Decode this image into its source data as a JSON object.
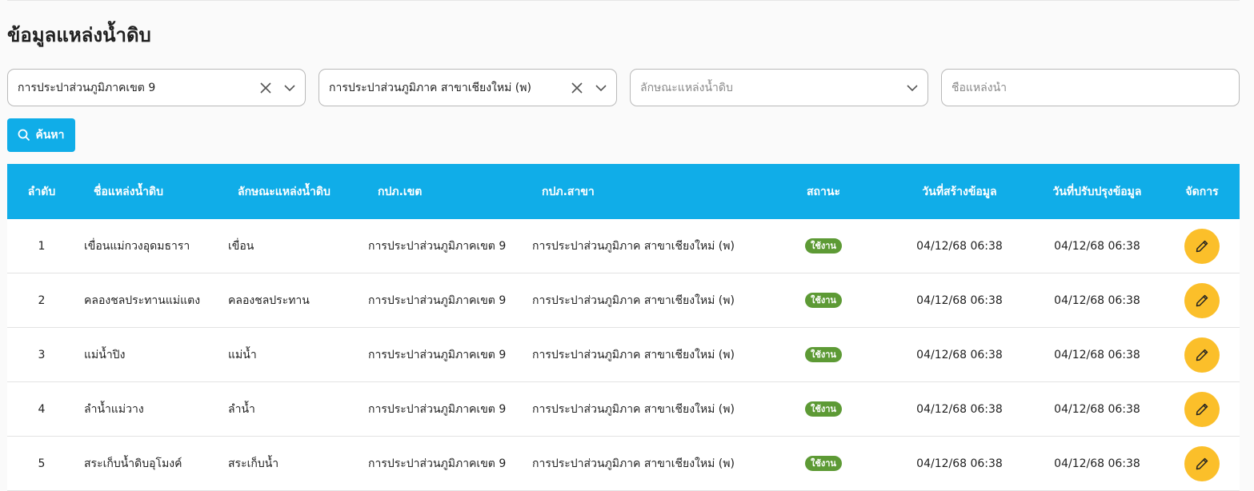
{
  "page": {
    "title": "ข้อมูลแหล่งน้ำดิบ"
  },
  "filters": {
    "zone": {
      "value": "การประปาส่วนภูมิภาคเขต 9"
    },
    "branch": {
      "value": "การประปาส่วนภูมิภาค สาขาเชียงใหม่ (พ)"
    },
    "source_type": {
      "placeholder": "ลักษณะแหล่งน้ำดิบ"
    },
    "source_name": {
      "placeholder": "ชื่อแหล่งน้ำ"
    }
  },
  "search_button": {
    "label": "ค้นหา",
    "icon": "search-icon"
  },
  "table": {
    "headers": {
      "no": "ลำดับ",
      "name": "ชื่อแหล่งน้ำดิบ",
      "type": "ลักษณะแหล่งน้ำดิบ",
      "zone": "กปภ.เขต",
      "branch": "กปภ.สาขา",
      "status": "สถานะ",
      "created": "วันที่สร้างข้อมูล",
      "updated": "วันที่ปรับปรุงข้อมูล",
      "actions": "จัดการ"
    },
    "rows": [
      {
        "no": "1",
        "name": "เขื่อนแม่กวงอุดมธารา",
        "type": "เขื่อน",
        "zone": "การประปาส่วนภูมิภาคเขต 9",
        "branch": "การประปาส่วนภูมิภาค สาขาเชียงใหม่ (พ)",
        "status": "ใช้งาน",
        "created": "04/12/68 06:38",
        "updated": "04/12/68 06:38"
      },
      {
        "no": "2",
        "name": "คลองชลประทานแม่แตง",
        "type": "คลองชลประทาน",
        "zone": "การประปาส่วนภูมิภาคเขต 9",
        "branch": "การประปาส่วนภูมิภาค สาขาเชียงใหม่ (พ)",
        "status": "ใช้งาน",
        "created": "04/12/68 06:38",
        "updated": "04/12/68 06:38"
      },
      {
        "no": "3",
        "name": "แม่น้ำปิง",
        "type": "แม่น้ำ",
        "zone": "การประปาส่วนภูมิภาคเขต 9",
        "branch": "การประปาส่วนภูมิภาค สาขาเชียงใหม่ (พ)",
        "status": "ใช้งาน",
        "created": "04/12/68 06:38",
        "updated": "04/12/68 06:38"
      },
      {
        "no": "4",
        "name": "ลำน้ำแม่วาง",
        "type": "ลำน้ำ",
        "zone": "การประปาส่วนภูมิภาคเขต 9",
        "branch": "การประปาส่วนภูมิภาค สาขาเชียงใหม่ (พ)",
        "status": "ใช้งาน",
        "created": "04/12/68 06:38",
        "updated": "04/12/68 06:38"
      },
      {
        "no": "5",
        "name": "สระเก็บน้ำดิบอุโมงค์",
        "type": "สระเก็บน้ำ",
        "zone": "การประปาส่วนภูมิภาคเขต 9",
        "branch": "การประปาส่วนภูมิภาค สาขาเชียงใหม่ (พ)",
        "status": "ใช้งาน",
        "created": "04/12/68 06:38",
        "updated": "04/12/68 06:38"
      }
    ]
  },
  "colors": {
    "accent": "#10ade8",
    "status_active": "#5d9a35",
    "edit_button": "#fbbf2a"
  }
}
